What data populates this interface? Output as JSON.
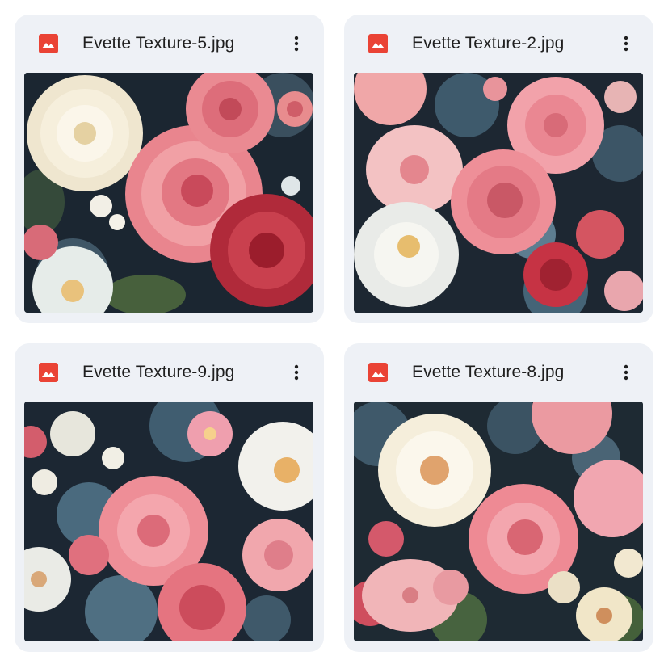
{
  "files": [
    {
      "name": "Evette Texture-5.jpg",
      "icon": "image-file-icon",
      "menu_icon": "more-vert-icon"
    },
    {
      "name": "Evette Texture-2.jpg",
      "icon": "image-file-icon",
      "menu_icon": "more-vert-icon"
    },
    {
      "name": "Evette Texture-9.jpg",
      "icon": "image-file-icon",
      "menu_icon": "more-vert-icon"
    },
    {
      "name": "Evette Texture-8.jpg",
      "icon": "image-file-icon",
      "menu_icon": "more-vert-icon"
    }
  ],
  "colors": {
    "card_background": "#eef1f6",
    "file_icon_red": "#ea4335",
    "text": "#1f1f1f",
    "thumbnail_dark": "#1c2630"
  }
}
